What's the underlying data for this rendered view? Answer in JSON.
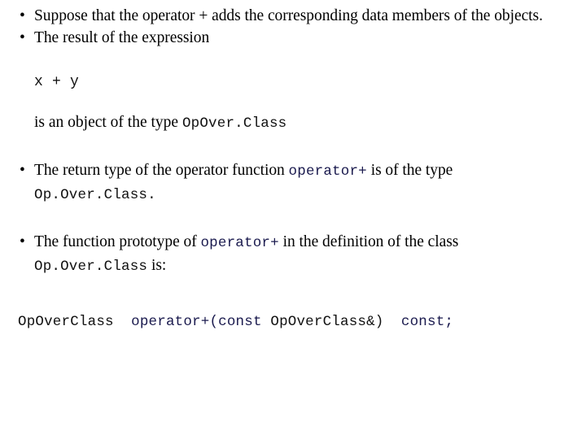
{
  "slide": {
    "background_color": "#ffffff",
    "text_color": "#000000",
    "code_color": "#1a1a4e",
    "bullet_glyph": "•",
    "blocks": {
      "bullet1": {
        "text": "Suppose that the operator + adds the corresponding data members of the objects."
      },
      "bullet2": {
        "text": "The result of the expression"
      },
      "expression": {
        "code": "x + y"
      },
      "type_line": {
        "prefix": "is an object of the type ",
        "code": "OpOver.Class",
        "suffix": ""
      },
      "bullet3": {
        "prefix": "The return type of the operator function ",
        "code": "operator+",
        "middle": " is of the type",
        "code2": "Op.Over.Class",
        "suffix": "."
      },
      "bullet4": {
        "prefix": "The function prototype of ",
        "code": "operator+",
        "middle": " in the definition of the class",
        "code2": "Op.Over.Class",
        "suffix": " is:"
      },
      "prototype": {
        "part1": "OpOverClass",
        "part2": "operator+(const",
        "part3": "OpOverClass&)",
        "part4": "const;",
        "full": "OpOverClass operator+(const OpOverClass&) const;"
      }
    }
  }
}
